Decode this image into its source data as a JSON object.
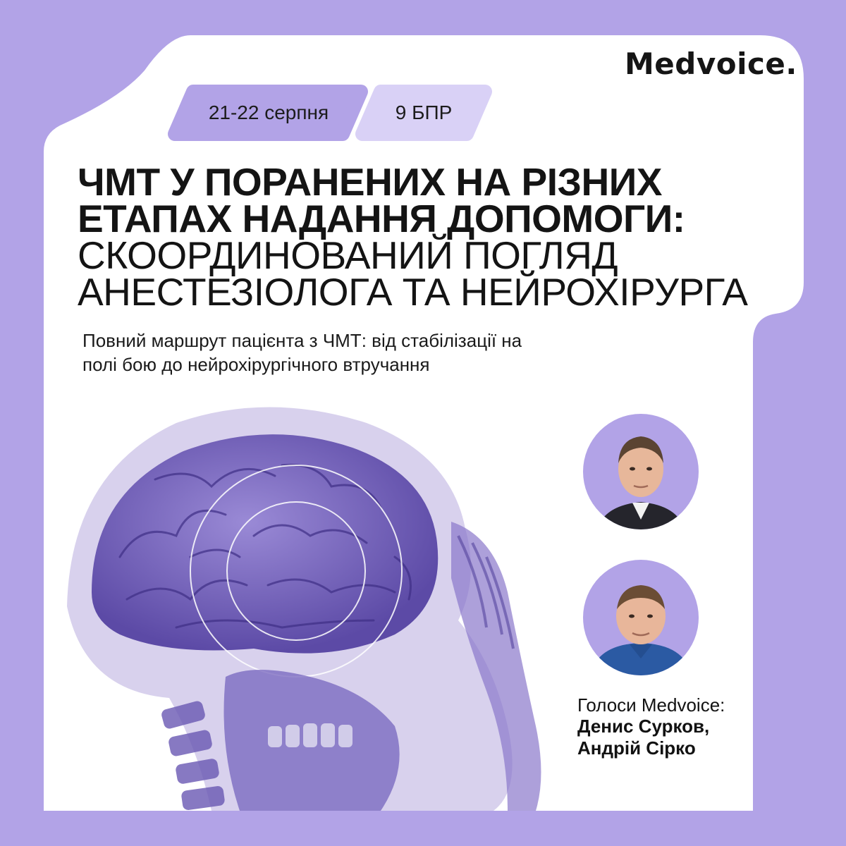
{
  "brand": {
    "logo_text": "Medvoice."
  },
  "event": {
    "date_label": "21-22 серпня",
    "points_label": "9 БПР"
  },
  "title": {
    "line1": "ЧМТ у поранених на різних",
    "line2": "етапах надання допомоги:",
    "line3": "скоординований погляд",
    "line4": "анестезіолога та нейрохірурга"
  },
  "subtitle": {
    "line1": "Повний маршрут пацієнта з ЧМТ: від стабілізації на",
    "line2": "полі бою до нейрохірургічного втручання"
  },
  "speakers": {
    "heading": "Голоси Medvoice:",
    "names": [
      "Денис Сурков,",
      "Андрій Сірко"
    ]
  },
  "colors": {
    "background": "#b2a3e7",
    "card": "#ffffff",
    "pill_date": "#b2a3e7",
    "pill_bpr": "#d9d1f6",
    "xray": "#6e5cb6",
    "text": "#141414"
  },
  "icons": {
    "xray_image": "brain-skull-xray-icon",
    "speaker1": "speaker-portrait-1",
    "speaker2": "speaker-portrait-2"
  }
}
